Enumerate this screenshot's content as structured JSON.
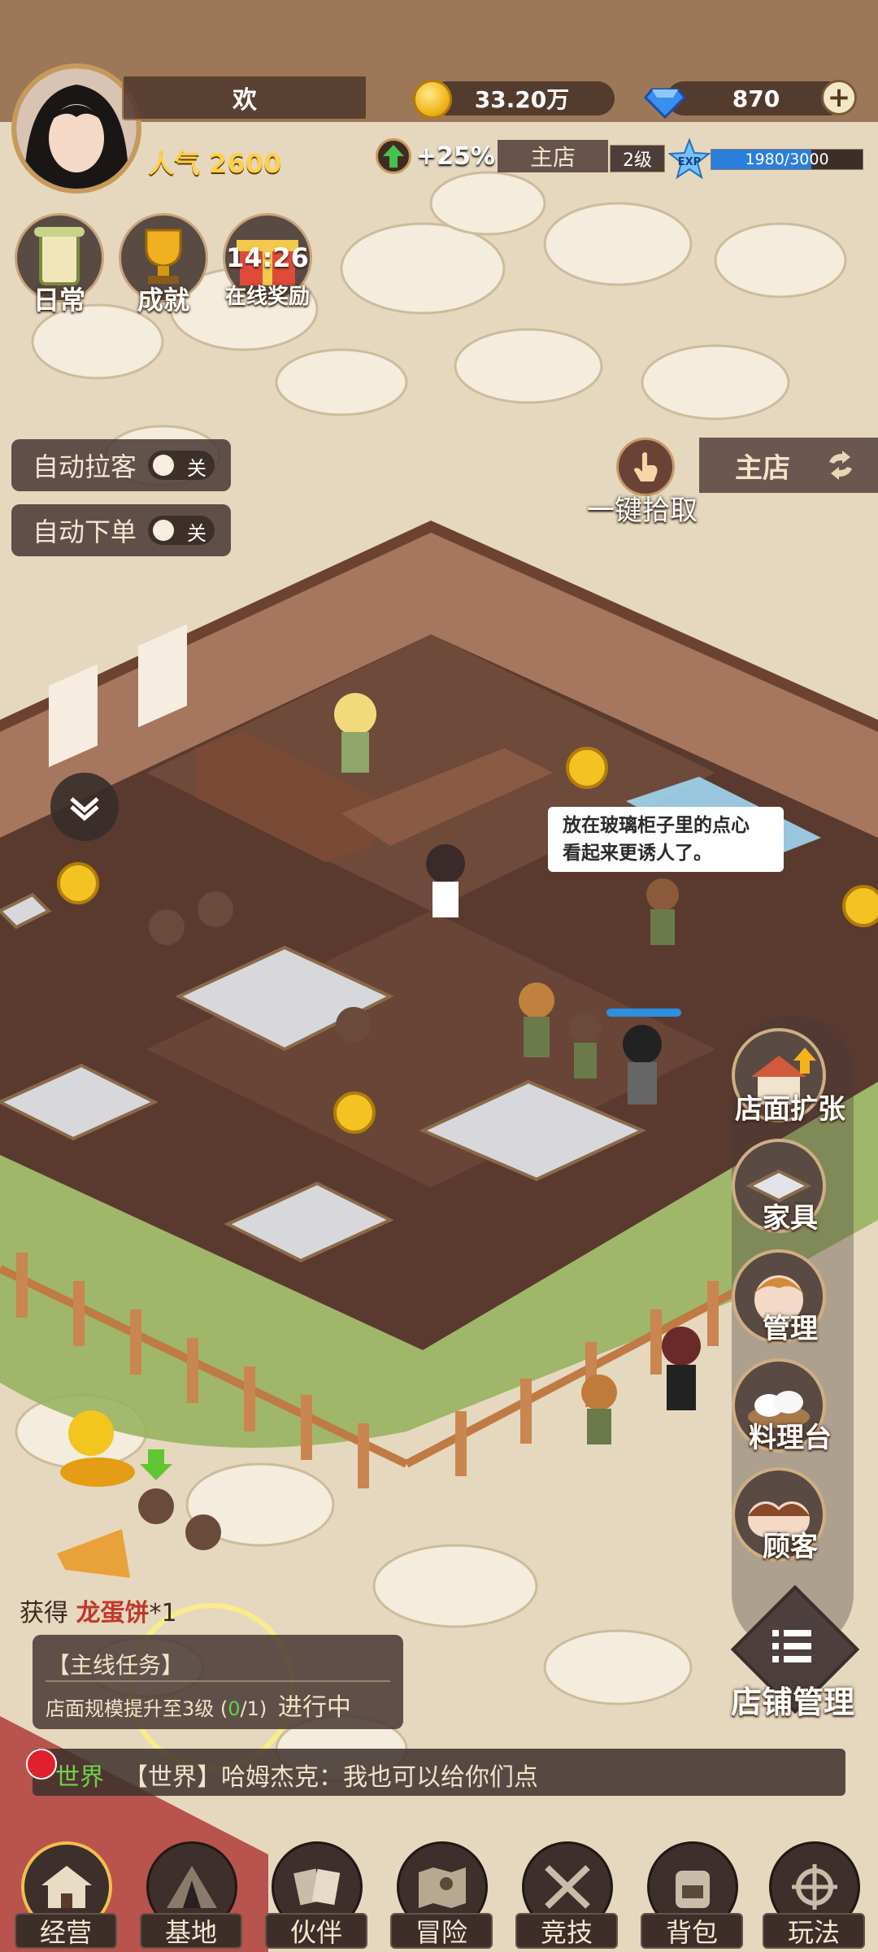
{
  "header": {
    "player_name": "欢",
    "popularity_label": "人气",
    "popularity_value": "2600",
    "coins": "33.20万",
    "gems": "870",
    "gem_add": "+",
    "boost": "+25%",
    "shop_name": "主店",
    "level": "2级",
    "exp_badge": "EXP",
    "exp_text": "1980/3000",
    "exp_fraction": 0.66
  },
  "quick_icons": [
    {
      "label": "日常",
      "icon": "scroll-icon"
    },
    {
      "label": "成就",
      "icon": "trophy-icon"
    },
    {
      "label": "在线奖励",
      "icon": "gift-icon",
      "timer": "14:26"
    }
  ],
  "toggles": [
    {
      "label": "自动拉客",
      "state": "关"
    },
    {
      "label": "自动下单",
      "state": "关"
    }
  ],
  "pickup_label": "一键拾取",
  "branch_label": "主店",
  "speech": [
    "放在玻璃柜子里的点心",
    "看起来更诱人了。"
  ],
  "right_menu": [
    {
      "label": "店面扩张",
      "icon": "shop-expand-icon"
    },
    {
      "label": "家具",
      "icon": "table-icon"
    },
    {
      "label": "管理",
      "icon": "staff-icon"
    },
    {
      "label": "料理台",
      "icon": "dumpling-icon"
    },
    {
      "label": "顾客",
      "icon": "customers-icon"
    }
  ],
  "store_manage_label": "店铺管理",
  "toast": {
    "prefix": "获得",
    "item": "龙蛋饼",
    "qty": "*1"
  },
  "quest": {
    "title": "【主线任务】",
    "desc": "店面规模提升至3级 (",
    "progress_done": "0",
    "progress_total": "/1)",
    "status": "进行中"
  },
  "chat": {
    "channel": "世界",
    "message": "【世界】哈姆杰克：我也可以给你们点"
  },
  "nav": [
    {
      "label": "经营",
      "icon": "house-icon",
      "active": true
    },
    {
      "label": "基地",
      "icon": "tent-icon"
    },
    {
      "label": "伙伴",
      "icon": "cards-icon"
    },
    {
      "label": "冒险",
      "icon": "map-icon"
    },
    {
      "label": "竞技",
      "icon": "swords-icon"
    },
    {
      "label": "背包",
      "icon": "backpack-icon"
    },
    {
      "label": "玩法",
      "icon": "wheel-icon"
    }
  ],
  "colors": {
    "accent_gold": "#ffcf4a",
    "exp_blue": "#2a7fdc",
    "panel": "#46372f"
  }
}
